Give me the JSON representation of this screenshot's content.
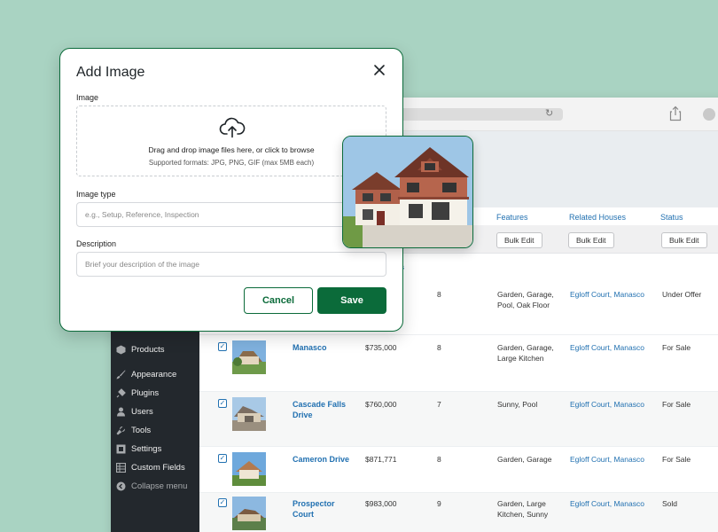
{
  "modal": {
    "title": "Add Image",
    "image_label": "Image",
    "drop_text": "Drag and drop image files here, or click to browse",
    "drop_subtext": "Supported formats: JPG, PNG, GIF (max 5MB each)",
    "type_label": "Image type",
    "type_placeholder": "e.g., Setup, Reference, Inspection",
    "description_label": "Description",
    "description_placeholder": "Brief your description of the image",
    "cancel_label": "Cancel",
    "save_label": "Save"
  },
  "sidebar": {
    "items": [
      {
        "label": "Products",
        "icon": "box-icon"
      },
      {
        "label": "Appearance",
        "icon": "brush-icon"
      },
      {
        "label": "Plugins",
        "icon": "plug-icon"
      },
      {
        "label": "Users",
        "icon": "user-icon"
      },
      {
        "label": "Tools",
        "icon": "wrench-icon"
      },
      {
        "label": "Settings",
        "icon": "settings-icon"
      },
      {
        "label": "Custom Fields",
        "icon": "grid-icon"
      },
      {
        "label": "Collapse menu",
        "icon": "collapse-icon"
      }
    ]
  },
  "table": {
    "columns": [
      "Features",
      "Related Houses",
      "Status"
    ],
    "bulk_edit_label": "Bulk Edit",
    "link_fragment": "es",
    "rows": [
      {
        "title": "",
        "price": "",
        "beds": "8",
        "features": "Garden, Garage, Pool, Oak Floor",
        "related_a": "Egloff Court",
        "related_b": "Manasco",
        "status": "Under Offer"
      },
      {
        "title": "Manasco",
        "price": "$735,000",
        "beds": "8",
        "features": "Garden, Garage, Large Kitchen",
        "related_a": "Egloff Court",
        "related_b": "Manasco",
        "status": "For Sale"
      },
      {
        "title": "Cascade Falls Drive",
        "price": "$760,000",
        "beds": "7",
        "features": "Sunny, Pool",
        "related_a": "Egloff Court",
        "related_b": "Manasco",
        "status": "For Sale"
      },
      {
        "title": "Cameron Drive",
        "price": "$871,771",
        "beds": "8",
        "features": "Garden, Garage",
        "related_a": "Egloff Court",
        "related_b": "Manasco",
        "status": "For Sale"
      },
      {
        "title": "Prospector Court",
        "price": "$983,000",
        "beds": "9",
        "features": "Garden, Large Kitchen, Sunny",
        "related_a": "Egloff Court",
        "related_b": "Manasco",
        "status": "Sold"
      }
    ]
  },
  "colors": {
    "accent": "#0b6b3a",
    "link": "#2271b1",
    "background": "#a9d3c2"
  }
}
